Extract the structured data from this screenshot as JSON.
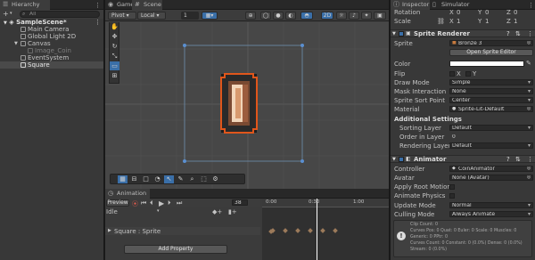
{
  "hierarchy": {
    "tab": "Hierarchy",
    "add": "+",
    "search_placeholder": "All",
    "scene": "SampleScene*",
    "items": [
      {
        "label": "Main Camera",
        "dim": false
      },
      {
        "label": "Global Light 2D",
        "dim": false
      },
      {
        "label": "Canvas",
        "dim": false
      },
      {
        "label": "Image_Coin",
        "dim": true
      },
      {
        "label": "EventSystem",
        "dim": false
      },
      {
        "label": "Square",
        "dim": false
      }
    ]
  },
  "scene": {
    "tabs": [
      "Game",
      "Scene"
    ],
    "pivot": "Pivot",
    "local": "Local",
    "grid_snap": "1",
    "mode_2d": "2D"
  },
  "animation": {
    "tab": "Animation",
    "preview": "Preview",
    "frame": "38",
    "clip": "Idle",
    "time_0": "0:00",
    "time_1": "0:30",
    "time_2": "1:00",
    "property": "Square : Sprite",
    "add_property": "Add Property",
    "keyframe_count": 10
  },
  "inspector": {
    "tabs": [
      "Inspector",
      "Simulator"
    ],
    "transform": {
      "rotation_label": "Rotation",
      "rotation": {
        "x": "0",
        "y": "0",
        "z": "0"
      },
      "scale_label": "Scale",
      "scale": {
        "x": "1",
        "y": "1",
        "z": "1"
      }
    },
    "sprite_renderer": {
      "title": "Sprite Renderer",
      "sprite_label": "Sprite",
      "sprite": "Bronze 3",
      "open_editor": "Open Sprite Editor",
      "color_label": "Color",
      "flip_label": "Flip",
      "flip_x": "X",
      "flip_y": "Y",
      "draw_mode_label": "Draw Mode",
      "draw_mode": "Simple",
      "mask_label": "Mask Interaction",
      "mask": "None",
      "sort_point_label": "Sprite Sort Point",
      "sort_point": "Center",
      "material_label": "Material",
      "material": "Sprite-Lit-Default",
      "additional": "Additional Settings",
      "sorting_layer_label": "Sorting Layer",
      "sorting_layer": "Default",
      "order_label": "Order in Layer",
      "order": "0",
      "rendering_layer_label": "Rendering Layer M",
      "rendering_layer": "Default"
    },
    "animator": {
      "title": "Animator",
      "controller_label": "Controller",
      "controller": "CoinAnimator",
      "avatar_label": "Avatar",
      "avatar": "None (Avatar)",
      "root_motion_label": "Apply Root Motion",
      "physics_label": "Animate Physics",
      "update_label": "Update Mode",
      "update": "Normal",
      "culling_label": "Culling Mode",
      "culling": "Always Animate",
      "info": [
        "Clip Count: 0",
        "Curves Pos: 0 Quat: 0 Euler: 0 Scale: 0 Muscles: 0",
        "Generic: 0 PPtr: 0",
        "Curves Count: 0 Constant: 0 (0.0%) Dense: 0 (0.0%)",
        "Stream: 0 (0.0%)"
      ]
    }
  },
  "colors": {
    "accent": "#3a6fa8",
    "selection": "#2c5d87",
    "highlight": "#e0561b"
  }
}
